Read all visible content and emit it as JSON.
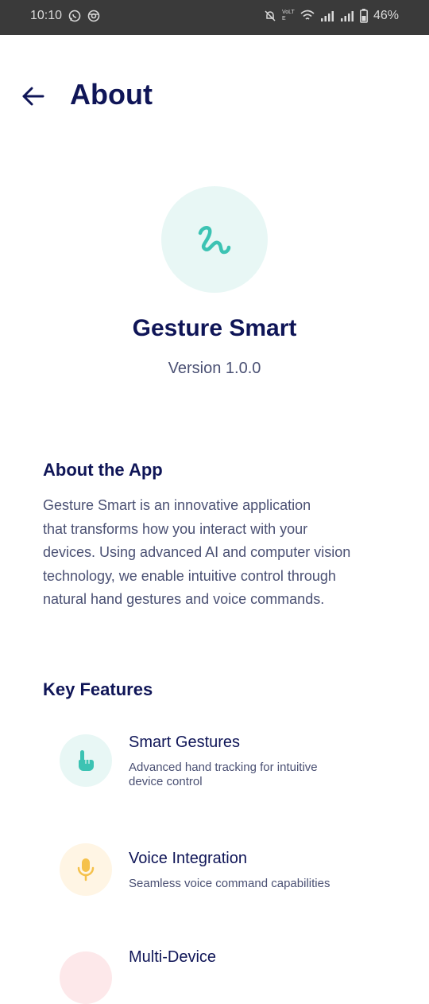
{
  "status_bar": {
    "time": "10:10",
    "battery": "46%",
    "network_label": "VoLTE"
  },
  "header": {
    "title": "About"
  },
  "app": {
    "name": "Gesture Smart",
    "version": "Version 1.0.0"
  },
  "about_section": {
    "title": "About the App",
    "lines": [
      "Gesture Smart is an innovative application",
      "that transforms how you interact with your",
      "devices. Using advanced AI and computer vision",
      "technology, we enable intuitive control through",
      "natural hand gestures and voice commands."
    ]
  },
  "features_section": {
    "title": "Key Features",
    "items": [
      {
        "title": "Smart Gestures",
        "desc_lines": [
          "Advanced hand tracking for intuitive",
          "device control"
        ],
        "icon": "hand-pointer-icon"
      },
      {
        "title": "Voice Integration",
        "desc_lines": [
          "Seamless voice command capabilities"
        ],
        "icon": "microphone-icon"
      },
      {
        "title": "Multi-Device",
        "desc_lines": [],
        "icon": "devices-icon"
      }
    ]
  },
  "colors": {
    "primary_text": "#0f1557",
    "secondary_text": "#4a5073",
    "teal_accent": "#3cc3b3",
    "teal_bg": "#e8f7f5",
    "amber_accent": "#f5c14b",
    "amber_bg": "#fff5e4",
    "pink_bg": "#fde8ea",
    "status_bar_bg": "#3a3a3a"
  }
}
